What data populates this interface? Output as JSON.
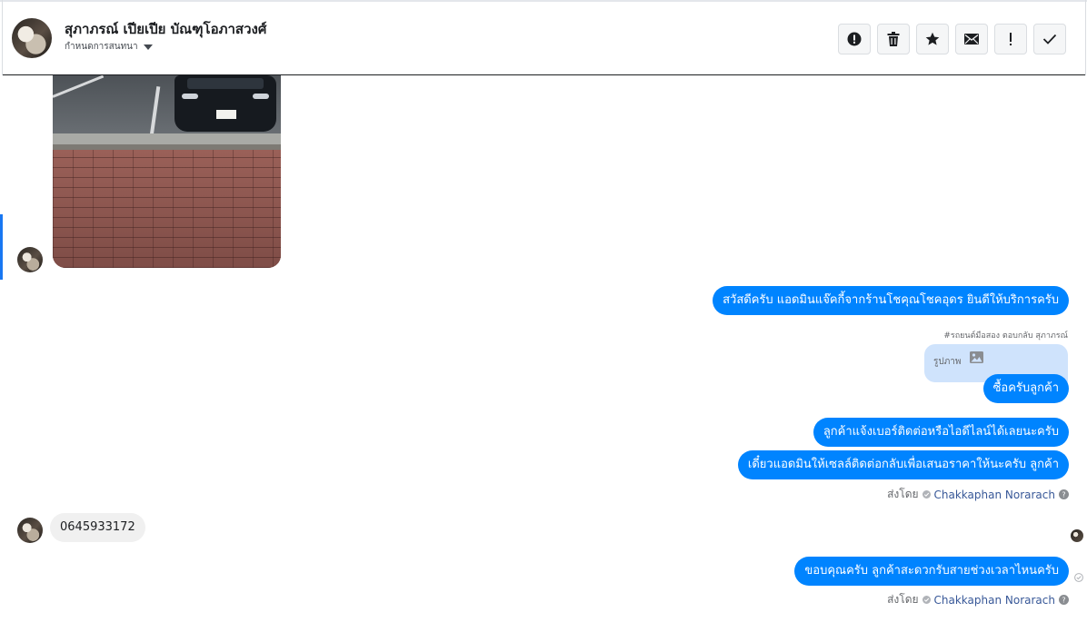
{
  "header": {
    "contact_name": "สุภาภรณ์ เปียเปีย บัณฑุโอภาสวงศ์",
    "assign_label": "กำหนดการสนทนา",
    "action_icons": [
      "alert-circle-icon",
      "trash-icon",
      "star-icon",
      "envelope-icon",
      "exclamation-icon",
      "check-icon"
    ]
  },
  "messages": {
    "out_1": "สวัสดีครับ แอดมินแจ๊คกี้จากร้านโชคุณโชคอุดร ยินดีให้บริการครับ",
    "reply_note": "#รถยนต์มือสอง ตอบกลับ สุภาภรณ์",
    "quoted_text": "รูปภาพ",
    "out_2": "ซื้อครับลูกค้า",
    "out_3": "ลูกค้าแจ้งเบอร์ติดต่อหรือไอดีไลน์ได้เลยนะครับ",
    "out_4": "เดี๋ยวแอดมินให้เซลล์ติดต่อกลับเพื่อเสนอราคาให้นะครับ ลูกค้า",
    "in_phone": "0645933172",
    "out_5": "ขอบคุณครับ ลูกค้าสะดวกรับสายช่วงเวลาไหนครับ"
  },
  "sent_by": {
    "label": "ส่งโดย",
    "agent": "Chakkaphan Norarach"
  },
  "colors": {
    "outgoing_bubble": "#0084ff",
    "incoming_bubble": "#f0f0f0",
    "quoted_bubble": "#cfe3fc",
    "agent_link": "#385898",
    "active_marker": "#1877f2"
  }
}
